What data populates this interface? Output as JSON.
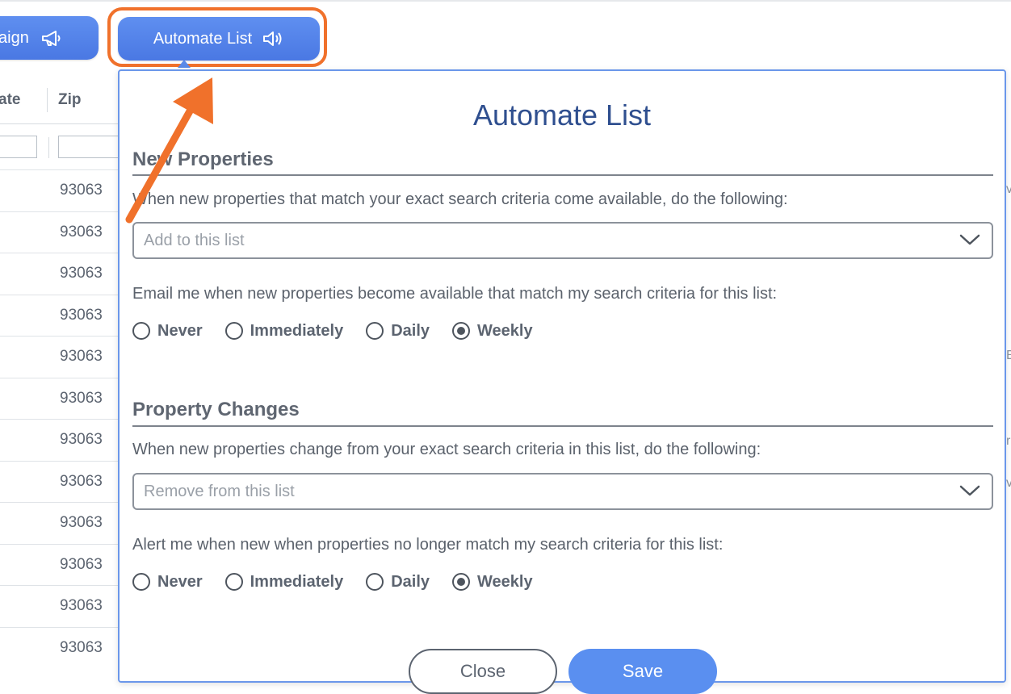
{
  "toolbar": {
    "campaign_label": "aign",
    "automate_label": "Automate List"
  },
  "table": {
    "headers": {
      "state": "ate",
      "zip": "Zip"
    },
    "zip_rows": [
      "93063",
      "93063",
      "93063",
      "93063",
      "93063",
      "93063",
      "93063",
      "93063",
      "93063",
      "93063",
      "93063",
      "93063"
    ]
  },
  "modal": {
    "title": "Automate List",
    "new_properties": {
      "title": "New Properties",
      "description": "When new properties that match your exact search criteria come available, do the following:",
      "select_value": "Add to this list",
      "email_label": "Email me when new properties become available that match my search criteria for this list:",
      "options": [
        "Never",
        "Immediately",
        "Daily",
        "Weekly"
      ],
      "selected": "Weekly"
    },
    "property_changes": {
      "title": "Property Changes",
      "description": "When new properties change from your exact search criteria in this list, do the following:",
      "select_value": "Remove from this list",
      "alert_label": "Alert me when new when properties no longer match my search criteria for this list:",
      "options": [
        "Never",
        "Immediately",
        "Daily",
        "Weekly"
      ],
      "selected": "Weekly"
    },
    "buttons": {
      "close": "Close",
      "save": "Save"
    }
  },
  "annotation": {
    "color": "#f0712b"
  },
  "colors": {
    "accent": "#5a8ff0",
    "title": "#2f4f8f"
  }
}
